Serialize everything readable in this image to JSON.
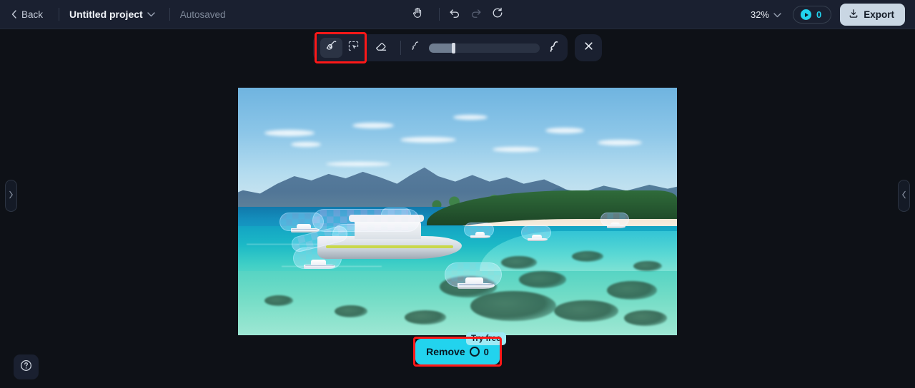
{
  "header": {
    "back_label": "Back",
    "back_icon": "chevron-left-icon",
    "project_name": "Untitled project",
    "project_chevron_icon": "chevron-down-icon",
    "autosaved_label": "Autosaved",
    "center_tools": [
      {
        "name": "hand-tool",
        "icon": "hand-icon"
      },
      {
        "name": "undo-button",
        "icon": "undo-arrow-icon"
      },
      {
        "name": "redo-button",
        "icon": "redo-arrow-icon"
      },
      {
        "name": "reset-button",
        "icon": "refresh-icon"
      }
    ],
    "zoom_level": "32%",
    "zoom_chevron_icon": "chevron-down-icon",
    "credits_icon": "credit-coin-icon",
    "credits_count": "0",
    "export_label": "Export",
    "export_icon": "download-icon"
  },
  "toolbar": {
    "brush_tool": {
      "label": "Brush",
      "icon": "brush-icon",
      "active": true
    },
    "select_tool": {
      "label": "Smart select",
      "icon": "magic-select-icon",
      "active": false
    },
    "eraser_tool": {
      "label": "Eraser",
      "icon": "eraser-icon",
      "active": false
    },
    "size_small_icon": "brush-size-small-icon",
    "size_large_icon": "brush-size-large-icon",
    "brush_size_percent": 22,
    "close_icon": "close-x-icon",
    "highlight_color": "#ff1818"
  },
  "canvas": {
    "image_alt": "Aerial photo of a tropical island beach with turquoise water, coral reef and several boats",
    "selection_mask_color": "#7f96e6",
    "selection_mask_accent": "#9a6ed2",
    "masked_objects": 9
  },
  "remove": {
    "label": "Remove",
    "credits_icon": "credit-coin-icon",
    "credits_cost": "0",
    "badge_label": "Try free",
    "button_color": "#22d3ee",
    "badge_color": "#9eeaf5",
    "highlight_color": "#ff1818"
  },
  "panels": {
    "left_tab_icon": "chevron-right-icon",
    "right_tab_icon": "chevron-left-icon",
    "help_icon": "question-mark-circle-icon"
  }
}
